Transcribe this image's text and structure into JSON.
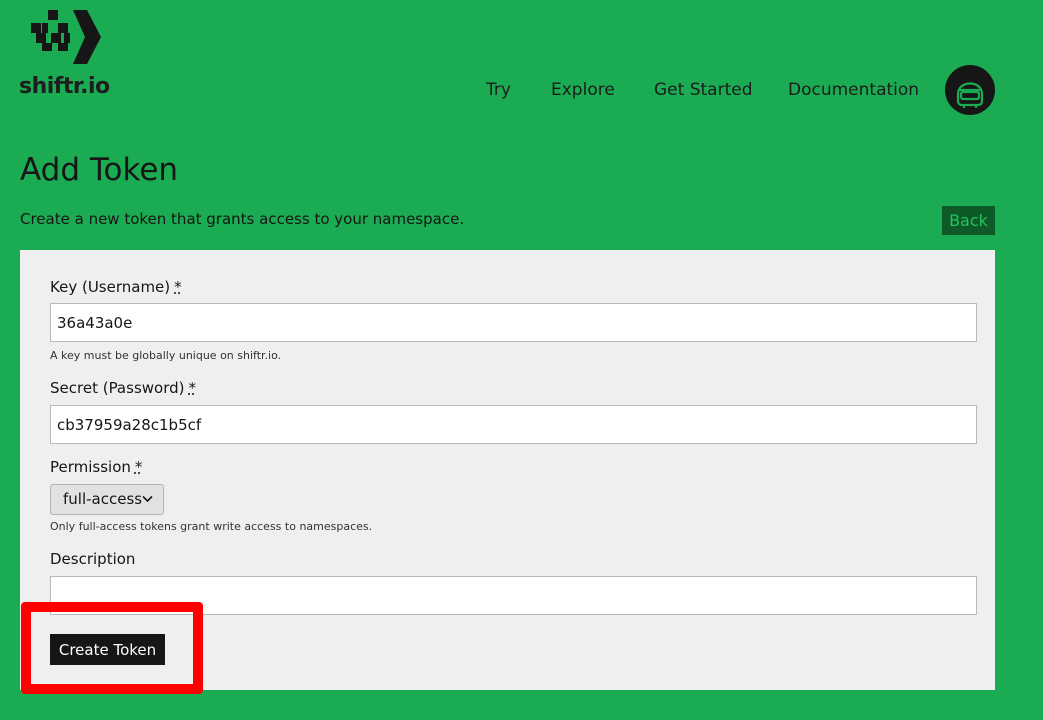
{
  "brand": {
    "name": "shiftr.io",
    "logo_icon": "pixel-arrow-logo"
  },
  "nav": {
    "items": [
      {
        "label": "Try"
      },
      {
        "label": "Explore"
      },
      {
        "label": "Get Started"
      },
      {
        "label": "Documentation"
      }
    ],
    "avatar_icon": "robot-helmet-avatar"
  },
  "page": {
    "title": "Add Token",
    "subtitle": "Create a new token that grants access to your namespace.",
    "back_label": "Back"
  },
  "form": {
    "key": {
      "label": "Key (Username)",
      "required_mark": "*",
      "value": "36a43a0e",
      "help": "A key must be globally unique on shiftr.io."
    },
    "secret": {
      "label": "Secret (Password)",
      "required_mark": "*",
      "value": "cb37959a28c1b5cf"
    },
    "permission": {
      "label": "Permission",
      "required_mark": "*",
      "selected": "full-access",
      "help": "Only full-access tokens grant write access to namespaces."
    },
    "description": {
      "label": "Description",
      "value": ""
    },
    "submit_label": "Create Token"
  },
  "colors": {
    "background": "#1bab52",
    "dark": "#161616",
    "panel": "#efefef",
    "back_button_bg": "#0d5a28",
    "back_button_text": "#23c35d",
    "highlight": "#ff0000"
  }
}
